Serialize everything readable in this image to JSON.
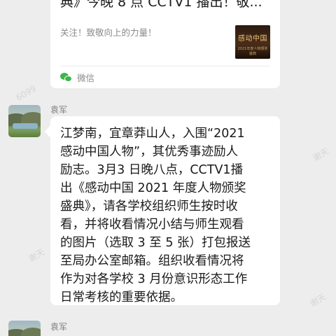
{
  "shared_card": {
    "title_line": "典》今晚 8 点 CCTV1 播出！敬...",
    "description": "关注！致敬向上的力量！",
    "thumbnail_title": "感动中国",
    "thumbnail_subtitle": "2021年度人物颁奖盛典",
    "source": "微信"
  },
  "messages": [
    {
      "sender": "袁军",
      "lines": [
        "江梦南，宜章莽山人，入围“2021",
        "感动中国人物”，其优秀事迹励人",
        "励志。3月3 日晚八点，CCTV1播",
        "出《感动中国 2021 年度人物颁奖",
        "盛典》，请各学校组织师生按时收",
        "看，并将收看情况小结与师生观看",
        "的图片（选取 3 至 5 张）打包报送",
        "至局办公室邮箱。组织收看情况将",
        "作为对各学校 3 月份意识形态工作",
        "日常考核的重要依据。"
      ]
    },
    {
      "sender": "袁军"
    }
  ],
  "watermarks": [
    "6099",
    "谢天",
    "谢天",
    "谢天"
  ],
  "colors": {
    "background": "#ededed",
    "bubble": "#ffffff",
    "wechat_green": "#3bb648"
  }
}
